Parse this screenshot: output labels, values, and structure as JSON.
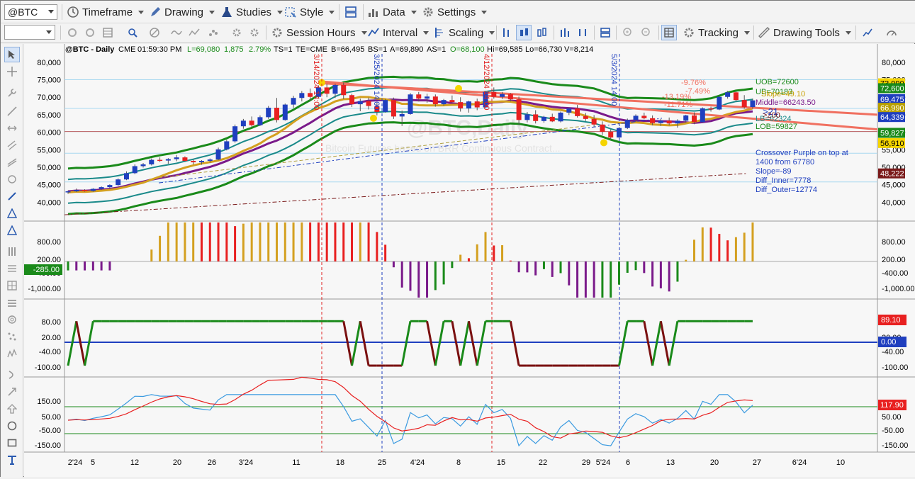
{
  "toolbar1": {
    "symbol": "@BTC",
    "timeframe": "Timeframe",
    "drawing": "Drawing",
    "studies": "Studies",
    "style": "Style",
    "data": "Data",
    "settings": "Settings"
  },
  "toolbar2": {
    "session_hours": "Session Hours",
    "interval": "Interval",
    "scaling": "Scaling",
    "tracking": "Tracking",
    "drawing_tools": "Drawing Tools"
  },
  "header": {
    "symbol": "@BTC - Daily",
    "exchange": "CME",
    "time": "01:59:30 PM",
    "last": "L=69,080",
    "change": "1,875",
    "pct": "2.79%",
    "ts": "TS=1",
    "te": "TE=CME",
    "bid": "B=66,495",
    "bs": "BS=1",
    "ask": "A=69,890",
    "as": "AS=1",
    "open": "O=68,100",
    "hi": "Hi=69,585",
    "lo": "Lo=66,730",
    "vol": "V=8,214"
  },
  "watermark": {
    "title": "@BTC,Daily",
    "subtitle": "Bitcoin Futures based on BRR Continuous Contract..."
  },
  "annotations": {
    "uob": "UOB=72600",
    "ub": "UB=70183",
    "slope": "Slope=49.10",
    "middle": "Middle=66243.50",
    "lb": "LB=62324",
    "lob": "LOB=59827",
    "gt21": ">21",
    "gt200": ">200",
    "pct1": "-9.76%",
    "pct2": "-7.49%",
    "pct3": "-13.19%",
    "pct4": "-11.71%",
    "crossover1": "Crossover Purple on top at",
    "crossover2": "1400 from 67780",
    "slope2": "Slope=-89",
    "diff_inner": "Diff_Inner=7778",
    "diff_outer": "Diff_Outer=12774",
    "vline1": "3/14/2024 14:00",
    "vline2": "3/25/2024 14:00",
    "vline3": "4/12/2024 14:00",
    "vline4": "5/3/2024 14:00"
  },
  "price_axis": {
    "left_ticks": [
      "80,000",
      "75,000",
      "70,000",
      "65,000",
      "60,000",
      "55,000",
      "50,000",
      "45,000",
      "40,000"
    ],
    "right_ticks": [
      "80,000",
      "75,000",
      "70,000",
      "65,000",
      "60,000",
      "55,000",
      "50,000",
      "45,000",
      "40,000"
    ],
    "badges": [
      {
        "text": "73,990",
        "bg": "#f5d400",
        "fg": "#000"
      },
      {
        "text": "72,600",
        "bg": "#1a8a1a",
        "fg": "#fff"
      },
      {
        "text": "69,475",
        "bg": "#1f3fbf",
        "fg": "#fff"
      },
      {
        "text": "66,990",
        "bg": "#b8a000",
        "fg": "#fff"
      },
      {
        "text": "64,339",
        "bg": "#1f3fbf",
        "fg": "#fff"
      },
      {
        "text": "59,827",
        "bg": "#1a8a1a",
        "fg": "#fff"
      },
      {
        "text": "56,910",
        "bg": "#f5d400",
        "fg": "#000"
      },
      {
        "text": "48,222",
        "bg": "#7a1a1a",
        "fg": "#fff"
      }
    ]
  },
  "macd_axis": {
    "left_ticks": [
      "800.00",
      "200.00",
      "-400.00",
      "-1,000.00"
    ],
    "right_ticks": [
      "800.00",
      "200.00",
      "-400.00",
      "-1,000.00"
    ],
    "left_badge": "-285.00"
  },
  "osc_axis": {
    "left_ticks": [
      "80.00",
      "20.00",
      "-40.00",
      "-100.00"
    ],
    "right_ticks": [
      "80.00",
      "20.00",
      "-40.00",
      "-100.00"
    ],
    "badge1": "89.10",
    "badge2": "0.00"
  },
  "cci_axis": {
    "left_ticks": [
      "150.00",
      "50.00",
      "-50.00",
      "-150.00"
    ],
    "right_ticks": [
      "150.00",
      "50.00",
      "-50.00",
      "-150.00"
    ],
    "badge": "117.90"
  },
  "date_axis": [
    "2'24",
    "5",
    "12",
    "20",
    "26",
    "3'24",
    "11",
    "18",
    "25",
    "4'24",
    "8",
    "15",
    "22",
    "29",
    "5'24",
    "6",
    "13",
    "20",
    "27",
    "6'24",
    "10"
  ],
  "colors": {
    "up": "#1f3fbf",
    "down": "#e82020",
    "green": "#1a8a1a",
    "purple": "#7a1a8a",
    "gold": "#d4a020",
    "teal": "#1a8a8a",
    "trend": "#f07060"
  },
  "chart_data": {
    "type": "candlestick",
    "title": "@BTC - Daily",
    "ylim": [
      35000,
      82000
    ],
    "x_labels": [
      "2'24",
      "5",
      "12",
      "20",
      "26",
      "3'24",
      "11",
      "18",
      "25",
      "4'24",
      "8",
      "15",
      "22",
      "29",
      "5'24",
      "6",
      "13",
      "20",
      "27",
      "6'24",
      "10"
    ],
    "candles": [
      [
        42800,
        43300,
        42400,
        43100
      ],
      [
        43100,
        43900,
        42900,
        43500
      ],
      [
        43500,
        43700,
        43000,
        43200
      ],
      [
        43200,
        44000,
        43000,
        43800
      ],
      [
        43800,
        44500,
        43500,
        44300
      ],
      [
        44300,
        45100,
        44000,
        44900
      ],
      [
        44900,
        46800,
        44700,
        46500
      ],
      [
        46500,
        48800,
        46300,
        48300
      ],
      [
        48300,
        50800,
        48000,
        50300
      ],
      [
        50300,
        51200,
        49900,
        50800
      ],
      [
        50800,
        52500,
        50500,
        52100
      ],
      [
        52100,
        52800,
        51500,
        51900
      ],
      [
        51900,
        52600,
        51000,
        52300
      ],
      [
        52300,
        53500,
        51700,
        52800
      ],
      [
        52800,
        53100,
        51500,
        51800
      ],
      [
        51800,
        52200,
        50800,
        51400
      ],
      [
        51400,
        52000,
        50700,
        51800
      ],
      [
        51800,
        52500,
        51300,
        52200
      ],
      [
        52200,
        55600,
        52000,
        55100
      ],
      [
        55100,
        57800,
        54800,
        57400
      ],
      [
        57400,
        62200,
        57000,
        61700
      ],
      [
        61700,
        63800,
        61000,
        63300
      ],
      [
        63300,
        64500,
        61500,
        62000
      ],
      [
        62000,
        64800,
        61800,
        64300
      ],
      [
        64300,
        67500,
        63800,
        67000
      ],
      [
        67000,
        69800,
        62800,
        63500
      ],
      [
        63500,
        68200,
        63300,
        67900
      ],
      [
        67900,
        70400,
        67000,
        69800
      ],
      [
        69800,
        71800,
        68800,
        71200
      ],
      [
        71200,
        72500,
        68800,
        70100
      ],
      [
        70100,
        73400,
        69600,
        72800
      ],
      [
        72800,
        73800,
        70000,
        71000
      ],
      [
        71000,
        73900,
        69800,
        73500
      ],
      [
        73500,
        74200,
        69500,
        70600
      ],
      [
        70600,
        71000,
        67200,
        68000
      ],
      [
        68000,
        69600,
        66000,
        68900
      ],
      [
        68900,
        69900,
        66500,
        67500
      ],
      [
        67500,
        68400,
        64800,
        65800
      ],
      [
        65800,
        69500,
        65600,
        69200
      ],
      [
        69200,
        69900,
        63800,
        64500
      ],
      [
        64500,
        66200,
        61800,
        65200
      ],
      [
        65200,
        71200,
        65000,
        70800
      ],
      [
        70800,
        71500,
        68800,
        69600
      ],
      [
        69600,
        71000,
        68400,
        70200
      ],
      [
        70200,
        70800,
        67300,
        68000
      ],
      [
        68000,
        69500,
        67600,
        69200
      ],
      [
        69200,
        70500,
        68400,
        68600
      ],
      [
        68600,
        70000,
        65900,
        66800
      ],
      [
        66800,
        69000,
        65600,
        68800
      ],
      [
        68800,
        69600,
        66300,
        67100
      ],
      [
        67100,
        71800,
        66900,
        71500
      ],
      [
        71500,
        72800,
        69600,
        70100
      ],
      [
        70100,
        71500,
        69500,
        70900
      ],
      [
        70900,
        71200,
        68800,
        69400
      ],
      [
        69400,
        70200,
        62000,
        63500
      ],
      [
        63500,
        65800,
        62800,
        65100
      ],
      [
        65100,
        66300,
        62500,
        63200
      ],
      [
        63200,
        64700,
        62700,
        64400
      ],
      [
        64400,
        65300,
        62900,
        63100
      ],
      [
        63100,
        65900,
        62800,
        65600
      ],
      [
        65600,
        67100,
        64900,
        66800
      ],
      [
        66800,
        67800,
        64200,
        64600
      ],
      [
        64600,
        65500,
        63200,
        63800
      ],
      [
        63800,
        64900,
        61500,
        62200
      ],
      [
        62200,
        63100,
        59200,
        60100
      ],
      [
        60100,
        60800,
        57800,
        58500
      ],
      [
        58500,
        61500,
        58200,
        61200
      ],
      [
        61200,
        63900,
        60900,
        63500
      ],
      [
        63500,
        65100,
        63000,
        64700
      ],
      [
        64700,
        65600,
        63700,
        64000
      ],
      [
        64000,
        64800,
        62000,
        62600
      ],
      [
        62600,
        63800,
        61800,
        63300
      ],
      [
        63300,
        64200,
        62000,
        62500
      ],
      [
        62500,
        63700,
        61300,
        63300
      ],
      [
        63300,
        65000,
        62700,
        64800
      ],
      [
        64800,
        65700,
        62300,
        62900
      ],
      [
        62900,
        67100,
        62700,
        66800
      ],
      [
        66800,
        67300,
        65900,
        66500
      ],
      [
        66500,
        70500,
        66300,
        70100
      ],
      [
        70100,
        71800,
        69600,
        71400
      ],
      [
        71400,
        71800,
        68800,
        69200
      ],
      [
        69200,
        70600,
        66700,
        67200
      ],
      [
        67200,
        69600,
        66700,
        69100
      ]
    ]
  }
}
